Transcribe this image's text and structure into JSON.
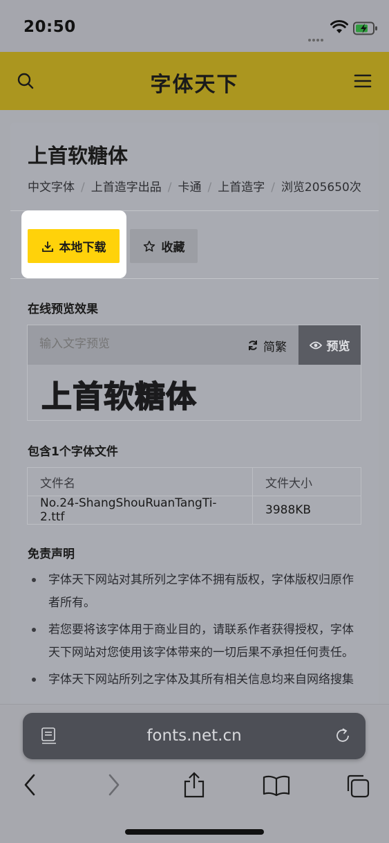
{
  "status_bar": {
    "time": "20:50"
  },
  "site": {
    "brand": "字体天下"
  },
  "font": {
    "title": "上首软糖体",
    "breadcrumbs": [
      "中文字体",
      "上首造字出品",
      "卡通",
      "上首造字",
      "浏览205650次"
    ],
    "actions": {
      "download_label": "本地下载",
      "favorite_label": "收藏"
    }
  },
  "preview": {
    "heading": "在线预览效果",
    "input_placeholder": "输入文字预览",
    "convert_label": "简繁",
    "preview_label": "预览",
    "sample_text": "上首软糖体"
  },
  "files": {
    "heading": "包含1个字体文件",
    "columns": [
      "文件名",
      "文件大小"
    ],
    "rows": [
      {
        "name": "No.24-ShangShouRuanTangTi-2.ttf",
        "size": "3988KB"
      }
    ]
  },
  "disclaimer": {
    "heading": "免责声明",
    "items": [
      "字体天下网站对其所列之字体不拥有版权，字体版权归原作者所有。",
      "若您要将该字体用于商业目的，请联系作者获得授权，字体天下网站对您使用该字体带来的一切后果不承担任何责任。",
      "字体天下网站所列之字体及其所有相关信息均来自网络搜集"
    ]
  },
  "browser": {
    "url": "fonts.net.cn"
  },
  "colors": {
    "header": "#ab961f",
    "download_button": "#ffd20a",
    "preview_button": "#5a5c63"
  }
}
